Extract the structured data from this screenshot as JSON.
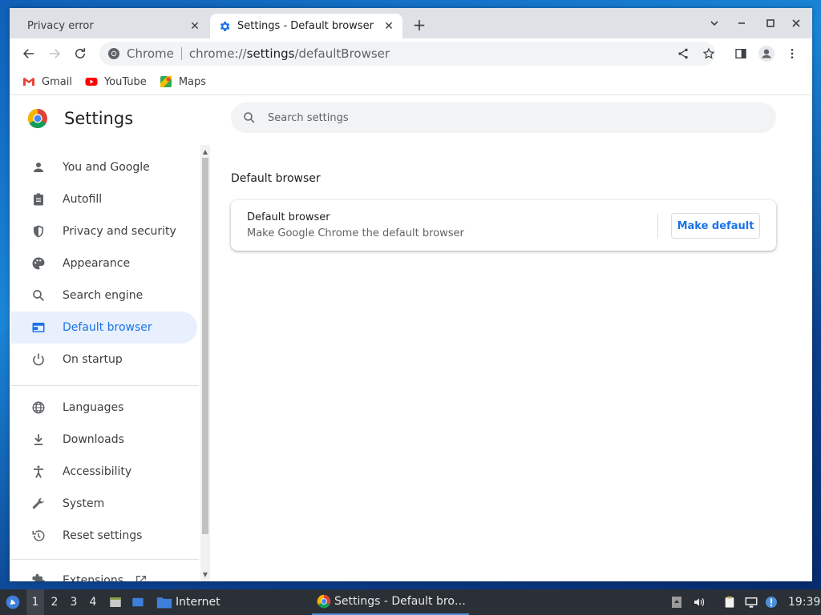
{
  "colors": {
    "accent": "#1a73e8",
    "selected_bg": "#e8f0fe",
    "tabstrip_bg": "#dee1e6",
    "taskbar_bg": "#2b2f36"
  },
  "tabs": [
    {
      "title": "Privacy error",
      "icon": "none",
      "active": false
    },
    {
      "title": "Settings - Default browser",
      "icon": "settings-gear-icon",
      "active": true
    }
  ],
  "toolbar": {
    "site_name": "Chrome",
    "url_scheme": "chrome://",
    "url_host": "settings",
    "url_path": "/defaultBrowser"
  },
  "bookmarks": [
    {
      "label": "Gmail",
      "icon": "gmail-icon"
    },
    {
      "label": "YouTube",
      "icon": "youtube-icon"
    },
    {
      "label": "Maps",
      "icon": "maps-icon"
    }
  ],
  "settings": {
    "title": "Settings",
    "search_placeholder": "Search settings",
    "nav": [
      {
        "label": "You and Google",
        "icon": "person-icon"
      },
      {
        "label": "Autofill",
        "icon": "clipboard-icon"
      },
      {
        "label": "Privacy and security",
        "icon": "shield-icon"
      },
      {
        "label": "Appearance",
        "icon": "palette-icon"
      },
      {
        "label": "Search engine",
        "icon": "search-icon"
      },
      {
        "label": "Default browser",
        "icon": "browser-window-icon",
        "selected": true
      },
      {
        "label": "On startup",
        "icon": "power-icon"
      },
      {
        "label": "Languages",
        "icon": "globe-icon"
      },
      {
        "label": "Downloads",
        "icon": "download-icon"
      },
      {
        "label": "Accessibility",
        "icon": "accessibility-icon"
      },
      {
        "label": "System",
        "icon": "wrench-icon"
      },
      {
        "label": "Reset settings",
        "icon": "history-icon"
      },
      {
        "label": "Extensions",
        "icon": "puzzle-icon"
      }
    ],
    "section_title": "Default browser",
    "card": {
      "title": "Default browser",
      "subtitle": "Make Google Chrome the default browser",
      "button": "Make default"
    }
  },
  "taskbar": {
    "workspaces": [
      "1",
      "2",
      "3",
      "4"
    ],
    "active_workspace": "1",
    "folder_label": "Internet",
    "task_label": "Settings - Default bro…",
    "clock": "19:39"
  }
}
